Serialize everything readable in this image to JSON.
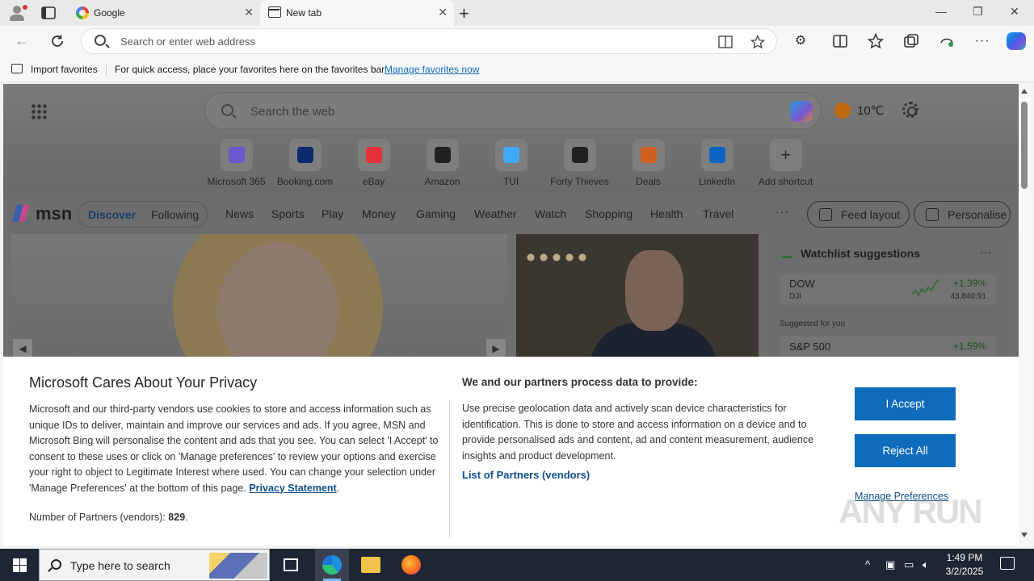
{
  "browser": {
    "tabs": [
      {
        "label": "Google"
      },
      {
        "label": "New tab"
      }
    ],
    "close_glyph": "✕",
    "new_tab_glyph": "+",
    "window_controls": {
      "minimize": "—",
      "restore": "❐",
      "close": "✕"
    },
    "address_placeholder": "Search or enter web address",
    "favorites_bar": {
      "import_label": "Import favorites",
      "message": "For quick access, place your favorites here on the favorites bar.",
      "link": "Manage favorites now"
    }
  },
  "msn": {
    "search_placeholder": "Search the web",
    "weather_temp": "10℃",
    "shortcuts": [
      {
        "label": "Microsoft 365",
        "color": "#6a5acd"
      },
      {
        "label": "Booking.com",
        "color": "#0a2a6b"
      },
      {
        "label": "eBay",
        "color": "#e53238"
      },
      {
        "label": "Amazon",
        "color": "#222222"
      },
      {
        "label": "TUI",
        "color": "#3fa9f5"
      },
      {
        "label": "Forty Thieves",
        "color": "#222222"
      },
      {
        "label": "Deals",
        "color": "#d06020"
      },
      {
        "label": "LinkedIn",
        "color": "#0a66c2"
      },
      {
        "label": "Add shortcut",
        "color": "#555555"
      }
    ],
    "logo_text": "msn",
    "feed_tabs": {
      "discover": "Discover",
      "following": "Following"
    },
    "nav": [
      "News",
      "Sports",
      "Play",
      "Money",
      "Gaming",
      "Weather",
      "Watch",
      "Shopping",
      "Health",
      "Travel"
    ],
    "more": "···",
    "feed_layout": "Feed layout",
    "personalise": "Personalise",
    "watchlist": {
      "title": "Watchlist suggestions",
      "more": "···",
      "item": {
        "symbol": "DOW",
        "sub": "DJI",
        "change": "+1.39%",
        "value": "43,840.91"
      },
      "suggested_label": "Suggested for you",
      "item2": {
        "symbol": "S&P 500",
        "change": "+1.59%"
      }
    }
  },
  "privacy": {
    "title": "Microsoft Cares About Your Privacy",
    "body": "Microsoft and our third-party vendors use cookies to store and access information such as unique IDs to deliver, maintain and improve our services and ads. If you agree, MSN and Microsoft Bing will personalise the content and ads that you see. You can select 'I Accept' to consent to these uses or click on 'Manage preferences' to review your options and exercise your right to object to Legitimate Interest where used.  You can change your selection under 'Manage Preferences' at the bottom of this page.",
    "privacy_link": "Privacy Statement",
    "partners_label": "Number of Partners (vendors):",
    "partners_count": "829",
    "right_title": "We and our partners process data to provide:",
    "right_body": "Use precise geolocation data and actively scan device characteristics for identification. This is done to store and access information on a device and to provide personalised ads and content, ad and content measurement, audience insights and product development.",
    "list_partners": "List of Partners (vendors)",
    "accept": "I Accept",
    "reject": "Reject All",
    "manage": "Manage Preferences"
  },
  "watermark": "ANY RUN",
  "taskbar": {
    "search_placeholder": "Type here to search",
    "time": "1:49 PM",
    "date": "3/2/2025"
  },
  "colors": {
    "accent": "#0f6cbd",
    "taskbar": "#1f2633"
  }
}
